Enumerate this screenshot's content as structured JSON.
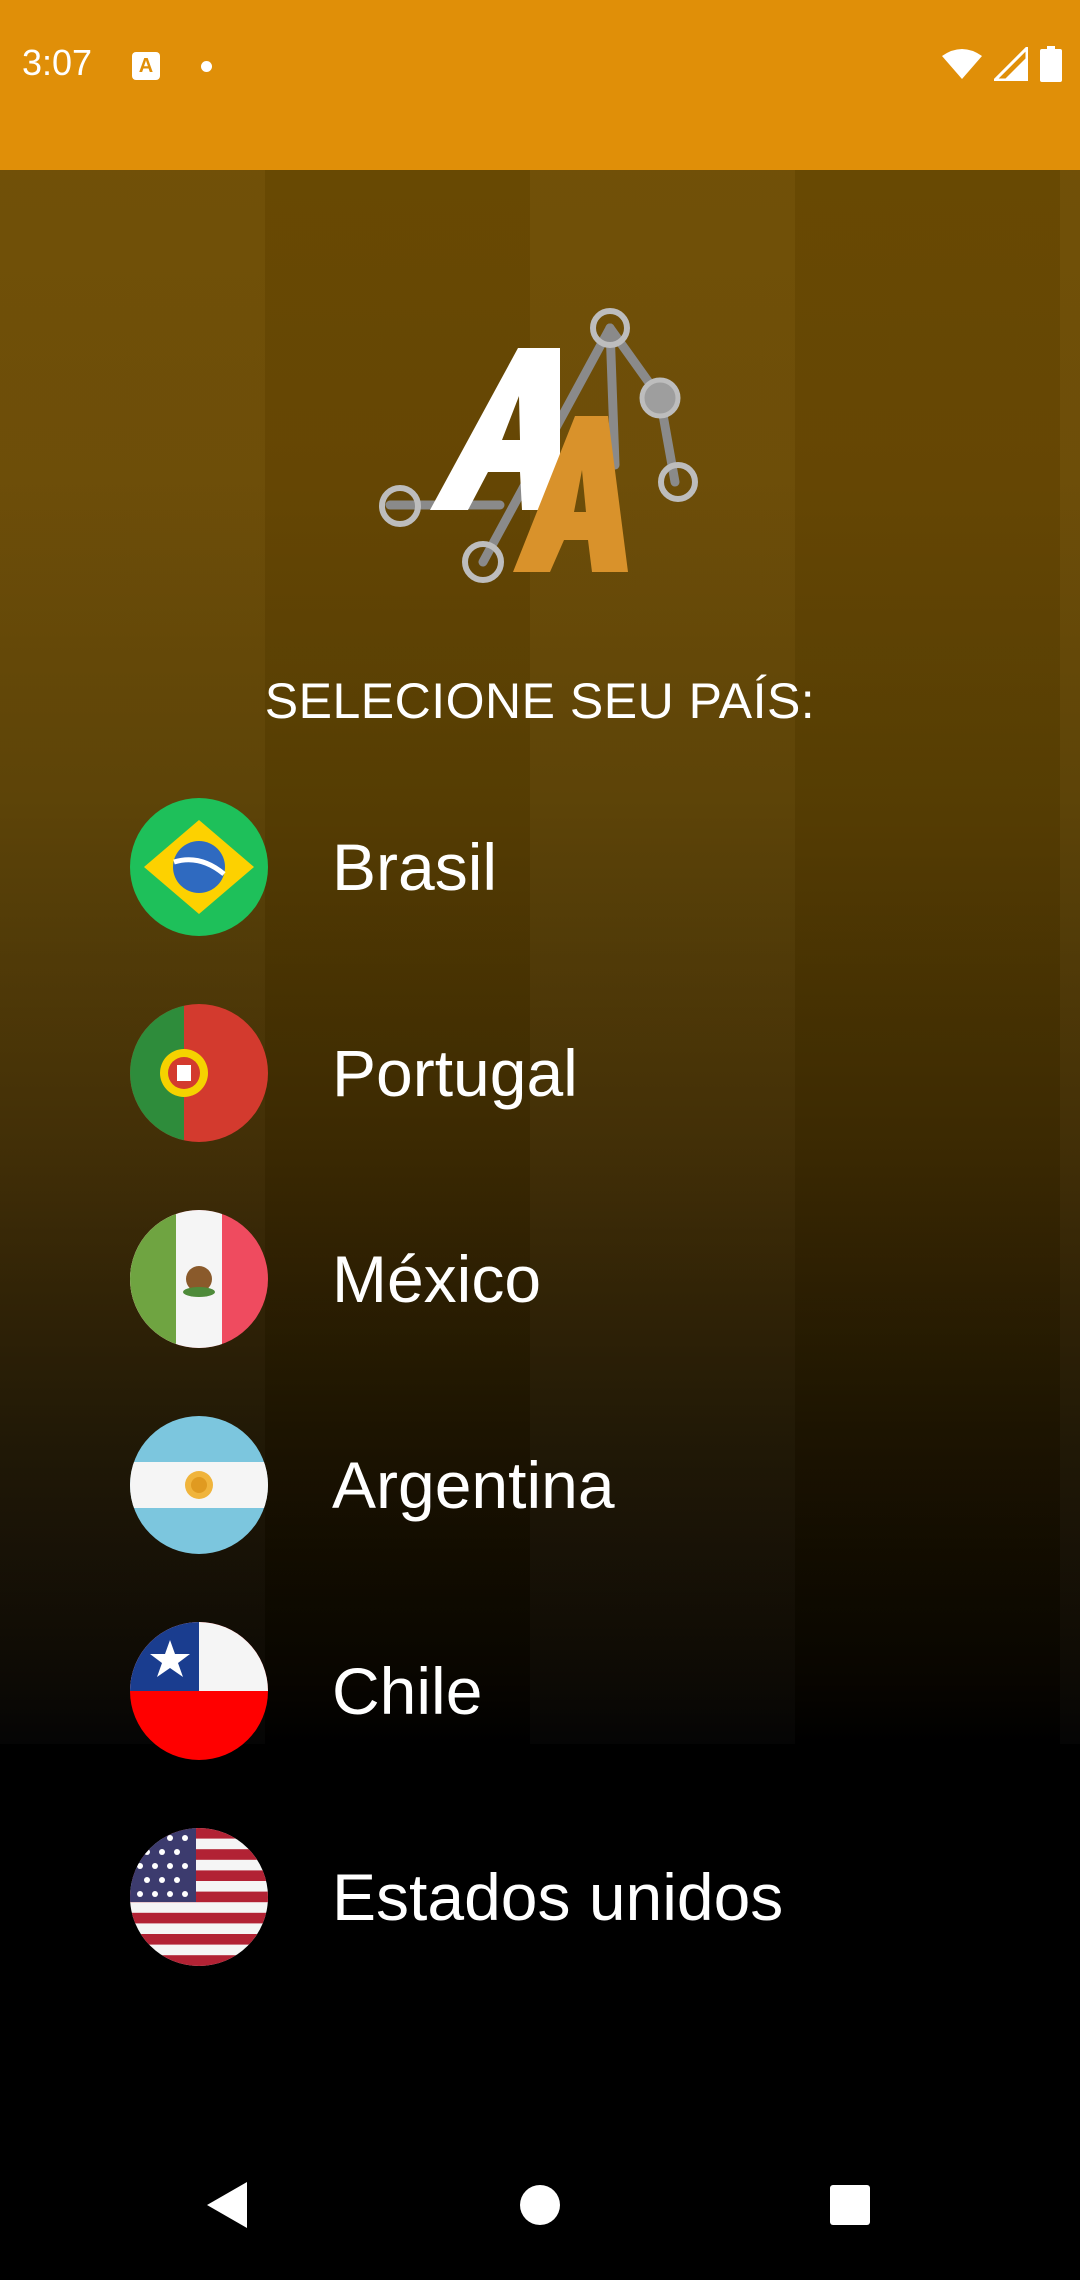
{
  "status_bar": {
    "time": "3:07",
    "notification_icon": "app-notification-icon",
    "notification_letter": "A",
    "icons": [
      "wifi-icon",
      "signal-icon",
      "battery-icon"
    ],
    "background_color": "#E08F08"
  },
  "logo": {
    "name": "aa-logo",
    "colors": {
      "primary": "#FFFFFF",
      "accent": "#D9922B",
      "nodes": "#9E9E9E"
    }
  },
  "prompt": "SELECIONE SEU PAÍS:",
  "countries": [
    {
      "label": "Brasil",
      "flag": "brazil-flag-icon"
    },
    {
      "label": "Portugal",
      "flag": "portugal-flag-icon"
    },
    {
      "label": "México",
      "flag": "mexico-flag-icon"
    },
    {
      "label": "Argentina",
      "flag": "argentina-flag-icon"
    },
    {
      "label": "Chile",
      "flag": "chile-flag-icon"
    },
    {
      "label": "Estados unidos",
      "flag": "usa-flag-icon"
    }
  ],
  "nav_bar": {
    "buttons": [
      "back-icon",
      "home-icon",
      "recents-icon"
    ]
  }
}
